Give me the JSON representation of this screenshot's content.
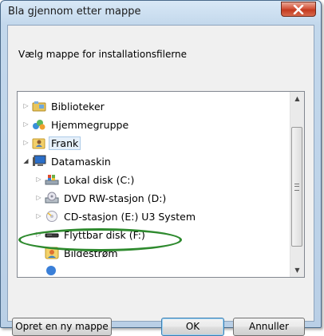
{
  "dialog": {
    "title": "Bla gjennom etter mappe",
    "instruction": "Vælg mappe for installationsfilerne"
  },
  "tree": {
    "items": [
      {
        "label": "Biblioteker",
        "icon": "library-icon",
        "expander": "collapsed"
      },
      {
        "label": "Hjemmegruppe",
        "icon": "homegroup-icon",
        "expander": "collapsed"
      },
      {
        "label": "Frank",
        "icon": "user-folder-icon",
        "expander": "collapsed",
        "selected": true
      },
      {
        "label": "Datamaskin",
        "icon": "computer-icon",
        "expander": "expanded"
      },
      {
        "label": "Lokal disk (C:)",
        "icon": "hard-disk-icon",
        "expander": "collapsed"
      },
      {
        "label": "DVD RW-stasjon (D:)",
        "icon": "dvd-drive-icon",
        "expander": "collapsed"
      },
      {
        "label": "CD-stasjon (E:) U3 System",
        "icon": "cd-drive-icon",
        "expander": "collapsed"
      },
      {
        "label": "Flyttbar disk (F:)",
        "icon": "removable-disk-icon",
        "expander": "collapsed",
        "highlighted": true
      },
      {
        "label": "Bildestrøm",
        "icon": "photo-stream-icon",
        "expander": "none"
      }
    ]
  },
  "buttons": {
    "new_folder": "Opret en ny mappe",
    "ok": "OK",
    "cancel": "Annuller"
  },
  "colors": {
    "highlight_ellipse": "#2e8a2e",
    "close_button": "#c9452a",
    "window_frame": "#c3d8ec"
  }
}
